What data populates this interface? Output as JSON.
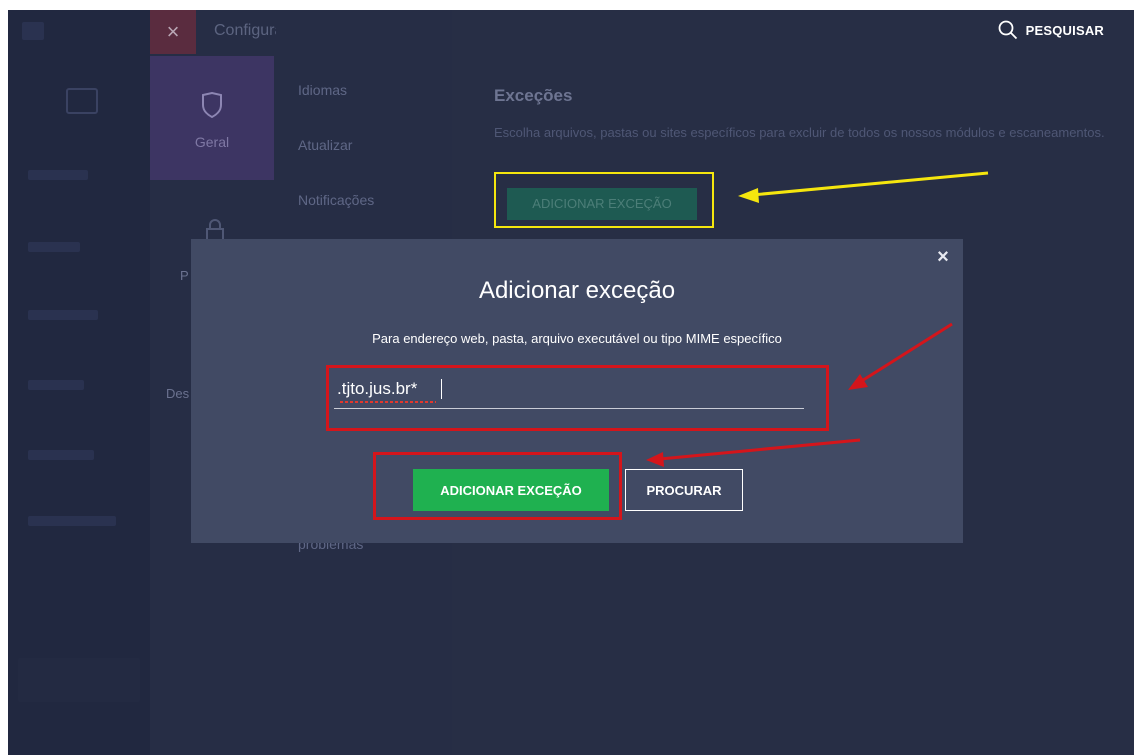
{
  "window": {
    "title": "Configurações",
    "close_glyph": "×"
  },
  "search": {
    "label": "PESQUISAR",
    "icon": "search-icon"
  },
  "categories": {
    "geral": "Geral",
    "p_partial": "P",
    "des_partial": "Des"
  },
  "submenu": {
    "items": [
      "Idiomas",
      "Atualizar",
      "Notificações"
    ],
    "problemas_partial": "problemas"
  },
  "content": {
    "title": "Exceções",
    "description": "Escolha arquivos, pastas ou sites específicos para excluir de todos os nossos módulos e escaneamentos.",
    "add_button": "ADICIONAR EXCEÇÃO"
  },
  "modal": {
    "title": "Adicionar exceção",
    "close_glyph": "×",
    "description": "Para endereço web, pasta, arquivo executável ou tipo MIME específico",
    "input_value": ".tjto.jus.br*",
    "add_button": "ADICIONAR EXCEÇÃO",
    "browse_button": "PROCURAR"
  },
  "colors": {
    "background": "#272e45",
    "modal": "#414a64",
    "accent_green": "#1fb150",
    "annotation_yellow": "#f5e60e",
    "annotation_red": "#d4151b"
  }
}
